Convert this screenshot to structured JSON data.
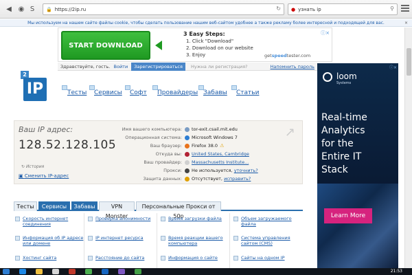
{
  "browser": {
    "url": "https://2ip.ru",
    "search_value": "узнать ip"
  },
  "cookie_notice": "Мы используем на нашем сайте файлы cookie, чтобы сделать пользование нашим веб-сайтом удобнее а также рекламу более интересной и подходящей для вас.",
  "ad": {
    "button": "START DOWNLOAD",
    "title": "3 Easy Steps:",
    "steps": [
      "1. Click \"Download\"",
      "2. Download on our website",
      "3. Enjoy"
    ],
    "brand_prefix": "get",
    "brand_main": "speed",
    "brand_suffix": "tester.com"
  },
  "login": {
    "greeting": "Здравствуйте, гость.",
    "login": "Войти",
    "register": "Зарегистрироваться",
    "question": "Нужна ли регистрация?",
    "remember": "Напомнить пароль"
  },
  "logo": {
    "number": "2",
    "text": "IP"
  },
  "nav": [
    "Тесты",
    "Сервисы",
    "Софт",
    "Провайдеры",
    "Забавы",
    "Статьи"
  ],
  "ipbox": {
    "label": "Ваш IP адрес:",
    "ip": "128.52.128.105",
    "history": "История",
    "change": "Сменить IP-адрес",
    "rows": [
      {
        "k": "Имя вашего компьютера:",
        "v": "tor-exit.csail.mit.edu"
      },
      {
        "k": "Операционная система:",
        "v": "Microsoft Windows 7"
      },
      {
        "k": "Ваш браузер:",
        "v": "Firefox 38.0"
      },
      {
        "k": "Откуда вы:",
        "v": "United States, Cambridge"
      },
      {
        "k": "Ваш провайдер:",
        "v": "Massachusetts Institute..."
      },
      {
        "k": "Прокси:",
        "v": "Не используется,",
        "link": "уточнить?"
      },
      {
        "k": "Защита данных:",
        "v": "Отсутствует,",
        "link": "исправить?"
      }
    ]
  },
  "tabs": [
    "Тесты",
    "Сервисы",
    "Забавы",
    "VPN Monster",
    "Персональные Прокси от 50р"
  ],
  "grid": [
    "Скорость интернет соединения",
    "Проверка анонимности",
    "Время загрузки файла",
    "Объем загружаемого файла",
    "Информация об IP адресе или домене",
    "IP интернет ресурса",
    "Время реакции вашего компьютера",
    "Система управления сайтом (CMS)",
    "Хостинг сайта",
    "Расстояние до сайта",
    "Информация о сайте",
    "Сайты на одном IP"
  ],
  "right_ad": {
    "brand": "loom",
    "sub": "Systems",
    "headline": [
      "Real-time",
      "Analytics",
      "for the",
      "Entire IT",
      "Stack"
    ],
    "cta": "Learn More"
  },
  "clock": "21:53"
}
